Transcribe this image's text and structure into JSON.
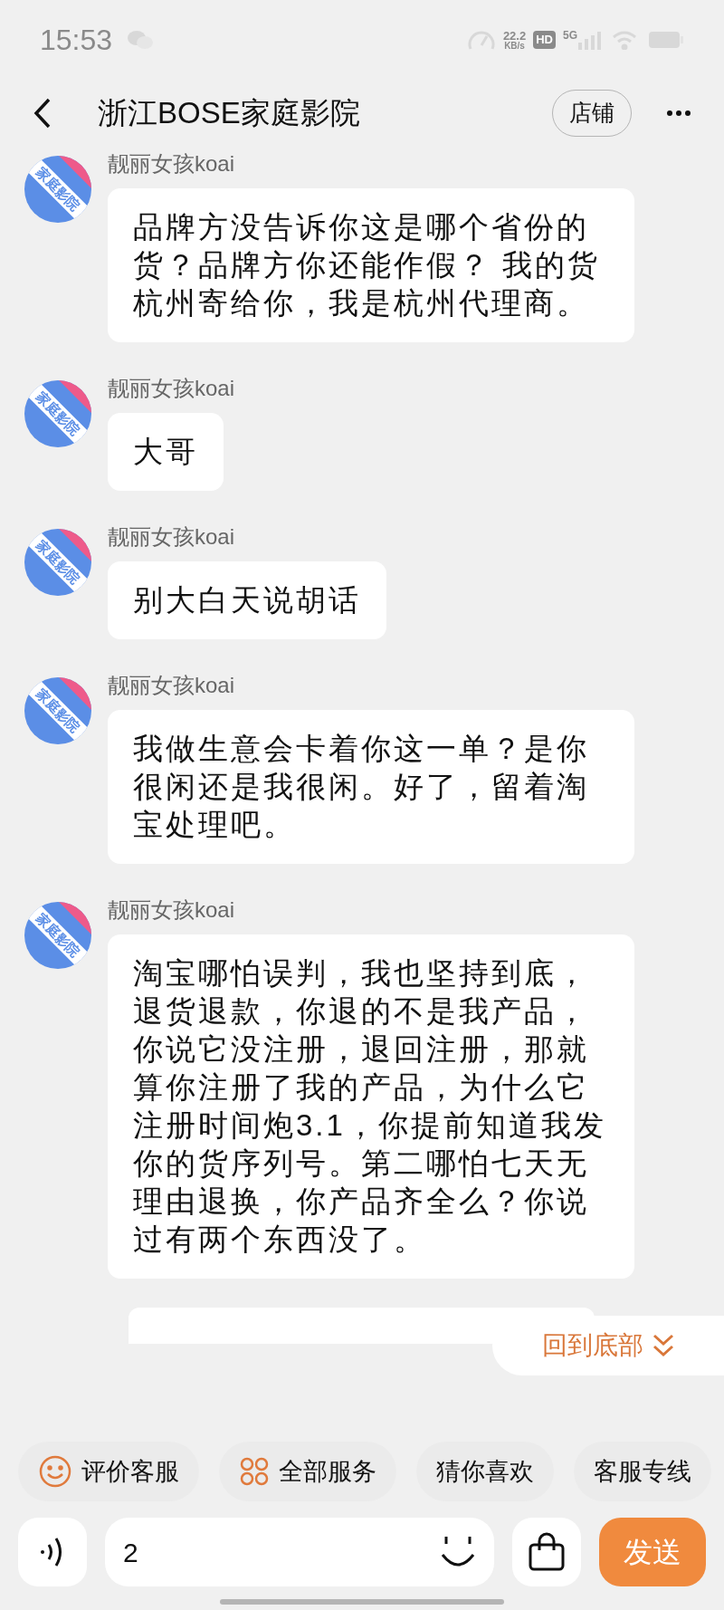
{
  "status_bar": {
    "time": "15:53",
    "speed_value": "22.2",
    "speed_unit": "KB/s",
    "hd": "HD",
    "network": "5G"
  },
  "header": {
    "title": "浙江BOSE家庭影院",
    "store_button": "店铺"
  },
  "messages": [
    {
      "sender": "靓丽女孩koai",
      "avatar_label": "家庭影院",
      "text": "品牌方没告诉你这是哪个省份的货？品牌方你还能作假？ 我的货杭州寄给你，我是杭州代理商。"
    },
    {
      "sender": "靓丽女孩koai",
      "avatar_label": "家庭影院",
      "text": "大哥"
    },
    {
      "sender": "靓丽女孩koai",
      "avatar_label": "家庭影院",
      "text": "别大白天说胡话"
    },
    {
      "sender": "靓丽女孩koai",
      "avatar_label": "家庭影院",
      "text": "我做生意会卡着你这一单？是你很闲还是我很闲。好了，留着淘宝处理吧。"
    },
    {
      "sender": "靓丽女孩koai",
      "avatar_label": "家庭影院",
      "text": "淘宝哪怕误判，我也坚持到底，退货退款，你退的不是我产品，你说它没注册，退回注册，那就算你注册了我的产品，为什么它注册时间炮3.1，你提前知道我发你的货序列号。第二哪怕七天无理由退换，你产品齐全么？你说过有两个东西没了。"
    }
  ],
  "jump_to_bottom": "回到底部",
  "quick_actions": [
    {
      "kind": "smile",
      "label": "评价客服"
    },
    {
      "kind": "grid",
      "label": "全部服务"
    },
    {
      "kind": "plain",
      "label": "猜你喜欢"
    },
    {
      "kind": "plain",
      "label": "客服专线"
    }
  ],
  "input": {
    "value": "2"
  },
  "send_button": "发送"
}
